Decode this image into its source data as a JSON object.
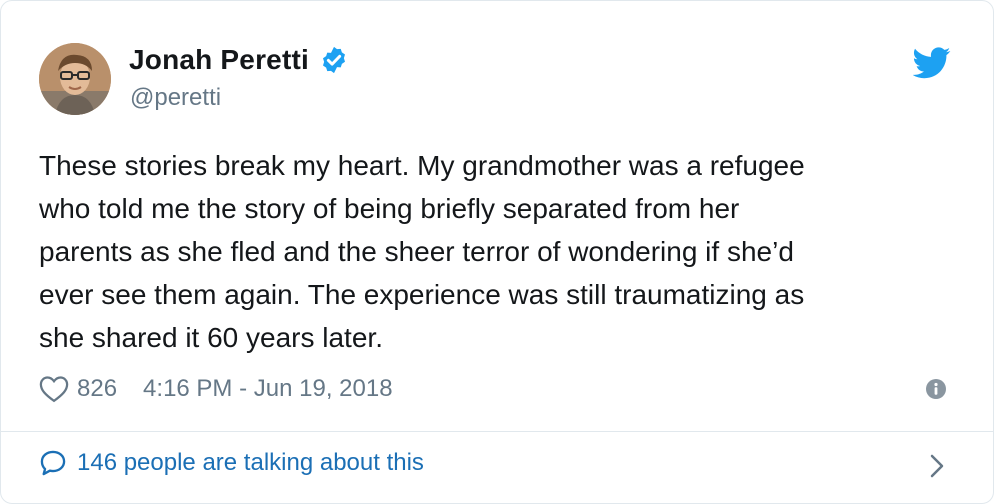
{
  "tweet": {
    "author": {
      "display_name": "Jonah Peretti",
      "handle": "@peretti",
      "verified": true,
      "avatar_icon": "profile-photo"
    },
    "text": "These stories break my heart. My grandmother was a refugee\nwho told me the story of being briefly separated from her\nparents as she fled and the sheer terror of wondering if she’d\never see them again. The experience was still traumatizing as\nshe shared it 60 years later.",
    "likes": "826",
    "timestamp": "4:16 PM - Jun 19, 2018",
    "conversation_label": "146 people are talking about this"
  },
  "icons": {
    "verified": "verified-badge-icon",
    "brand": "twitter-bird-icon",
    "like": "heart-icon",
    "info": "info-icon",
    "reply": "speech-bubble-icon",
    "chevron": "chevron-right-icon"
  },
  "colors": {
    "brand_blue": "#1da1f2",
    "link_blue": "#1b6fb5",
    "text": "#14171a",
    "secondary": "#657786",
    "border": "#e1e8ed"
  }
}
